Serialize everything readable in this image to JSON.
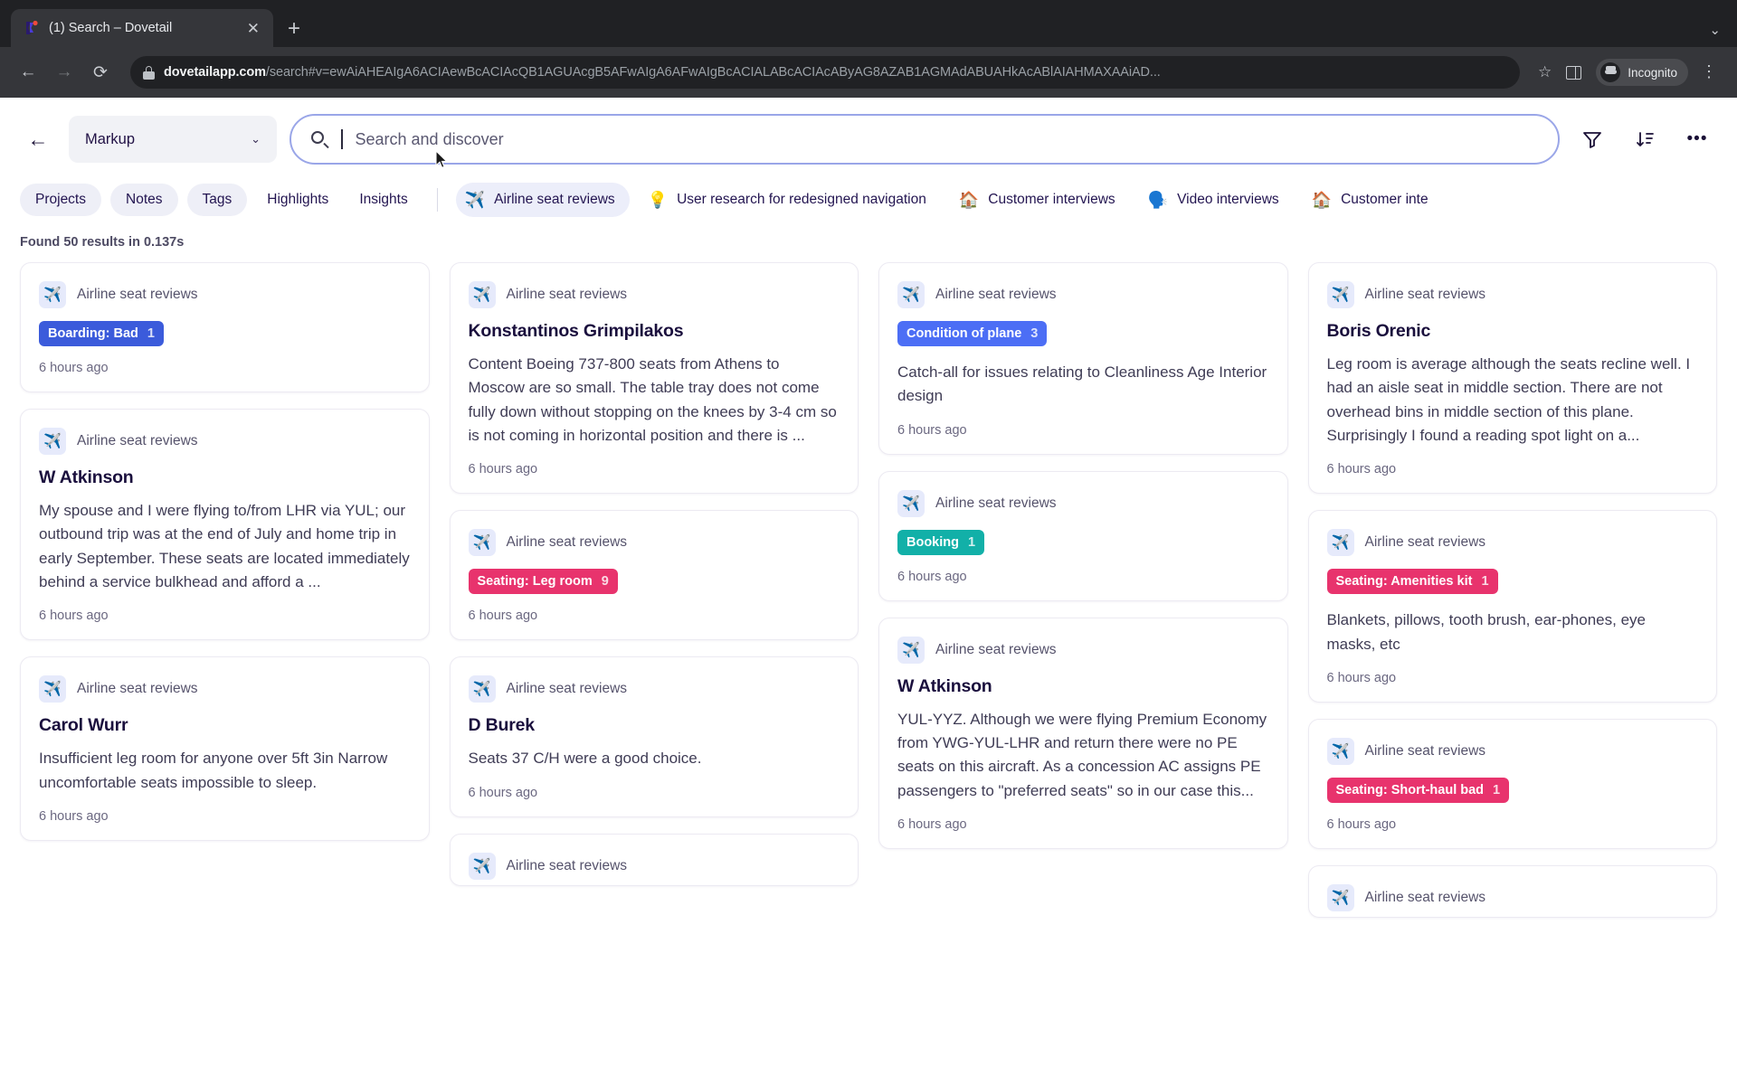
{
  "browser": {
    "tab_title": "(1) Search – Dovetail",
    "close_label": "✕",
    "newtab_label": "+",
    "tabstrip_chevron": "⌄",
    "back_label": "←",
    "forward_label": "→",
    "reload_label": "⟳",
    "url_domain": "dovetailapp.com",
    "url_path": "/search#v=ewAiAHEAIgA6ACIAewBcACIAcQB1AGUAcgB5AFwAIgA6AFwAIgBcACIALABcACIAcAByAG8AZAB1AGMAdABUAHkAcABlAIAHMAXAAiAD...",
    "star_label": "☆",
    "incognito_label": "Incognito",
    "menu_label": "⋮"
  },
  "header": {
    "back_icon_label": "←",
    "scope_label": "Markup",
    "scope_chevron": "⌄",
    "search_placeholder": "Search and discover",
    "filter_icon_label": "filter",
    "sort_icon_label": "sort",
    "more_icon_label": "•••"
  },
  "chips": {
    "pills": [
      "Projects",
      "Notes",
      "Tags"
    ],
    "plain": [
      "Highlights",
      "Insights"
    ],
    "projects": [
      {
        "emoji": "✈️",
        "label": "Airline seat reviews",
        "active": true
      },
      {
        "emoji": "💡",
        "label": "User research for redesigned navigation",
        "active": false
      },
      {
        "emoji": "🏠",
        "label": "Customer interviews",
        "active": false
      },
      {
        "emoji": "🗣️",
        "label": "Video interviews",
        "active": false
      },
      {
        "emoji": "🏠",
        "label": "Customer inte",
        "active": false
      }
    ]
  },
  "results": {
    "meta": "Found 50 results in 0.137s",
    "source_label": "Airline seat reviews",
    "source_emoji": "✈️",
    "time_label": "6 hours ago",
    "columns": [
      [
        {
          "badge": {
            "text": "Boarding: Bad",
            "count": "1",
            "color": "#3b5bdb"
          }
        },
        {
          "title": "W Atkinson",
          "body": "My spouse and I were flying to/from LHR via YUL; our outbound trip was at the end of July and home trip in early September. These seats are located immediately behind a service bulkhead and afford a ..."
        },
        {
          "title": "Carol Wurr",
          "body": "Insufficient leg room for anyone over 5ft 3in Narrow uncomfortable seats impossible to sleep."
        },
        {
          "partial": true
        }
      ],
      [
        {
          "title": "Konstantinos Grimpilakos",
          "body": "Content Boeing 737-800 seats from Athens to Moscow are so small. The table tray does not come fully down without stopping on the knees by 3-4 cm so is not coming in horizontal position and there is ..."
        },
        {
          "badge": {
            "text": "Seating: Leg room",
            "count": "9",
            "color": "#e8336d"
          }
        },
        {
          "title": "D Burek",
          "body": "Seats 37 C/H were a good choice."
        },
        {
          "partial": true
        }
      ],
      [
        {
          "badge": {
            "text": "Condition of plane",
            "count": "3",
            "color": "#4c6ef5"
          },
          "body": "Catch-all for issues relating to Cleanliness Age Interior design"
        },
        {
          "badge": {
            "text": "Booking",
            "count": "1",
            "color": "#12b0a8"
          }
        },
        {
          "title": "W Atkinson",
          "body": "YUL-YYZ. Although we were flying Premium Economy from YWG-YUL-LHR and return there were no PE seats on this aircraft. As a concession AC assigns PE passengers to \"preferred seats\" so in our case this..."
        },
        {
          "partial": true
        }
      ],
      [
        {
          "title": "Boris Orenic",
          "body": "Leg room is average although the seats recline well. I had an aisle seat in middle section. There are not overhead bins in middle section of this plane. Surprisingly I found a reading spot light on a..."
        },
        {
          "badge": {
            "text": "Seating: Amenities kit",
            "count": "1",
            "color": "#e8336d"
          },
          "body": "Blankets, pillows, tooth brush, ear-phones, eye masks, etc"
        },
        {
          "badge": {
            "text": "Seating: Short-haul bad",
            "count": "1",
            "color": "#e8336d"
          }
        },
        {
          "partial": true
        }
      ]
    ]
  }
}
